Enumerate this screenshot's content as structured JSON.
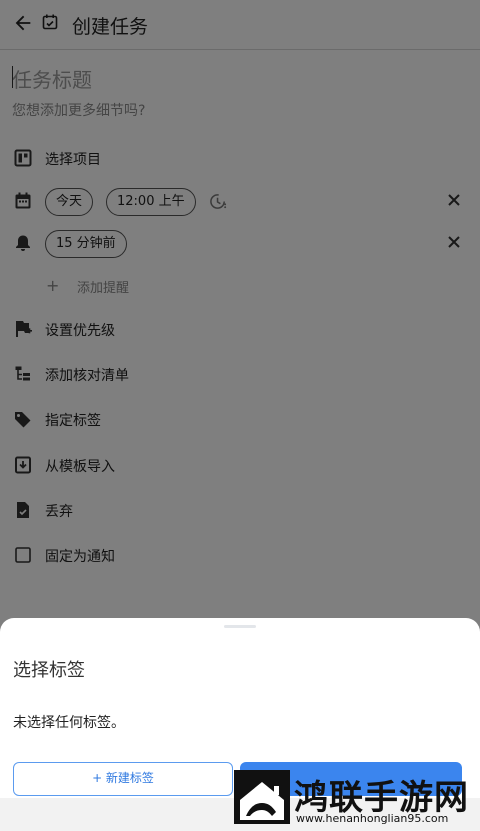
{
  "app_bar": {
    "title": "创建任务"
  },
  "task": {
    "title_placeholder": "任务标题",
    "details_prompt": "您想添加更多细节吗?"
  },
  "rows": {
    "project": "选择项目",
    "date_chip": "今天",
    "time_chip": "12:00 上午",
    "reminder_chip": "15 分钟前",
    "add_reminder": "添加提醒",
    "priority": "设置优先级",
    "checklist": "添加核对清单",
    "tags": "指定标签",
    "template": "从模板导入",
    "discard": "丢弃",
    "pin": "固定为通知"
  },
  "sheet": {
    "title": "选择标签",
    "empty_message": "未选择任何标签。",
    "new_tag_label": "+ 新建标签"
  },
  "watermark": {
    "name": "鸿联手游网",
    "url": "www.henanhonglian95.com"
  },
  "colors": {
    "accent": "#3b85ee",
    "scrim": "rgba(0,0,0,0.5)"
  }
}
